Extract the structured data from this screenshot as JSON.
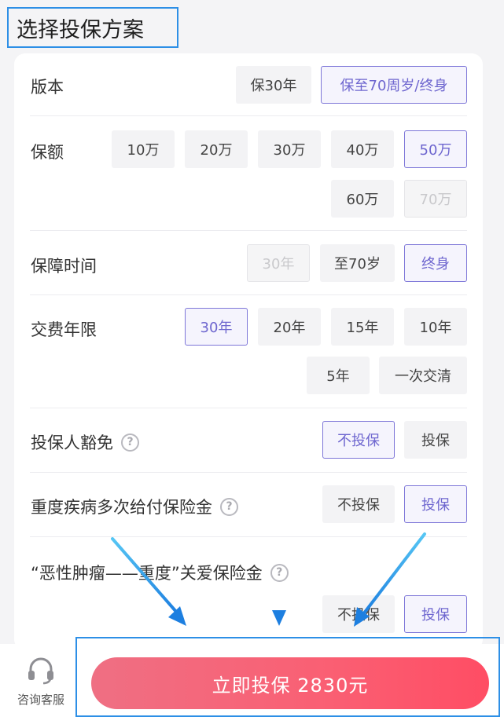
{
  "header": {
    "title": "选择投保方案"
  },
  "version": {
    "label": "版本",
    "options": [
      "保30年",
      "保至70周岁/终身"
    ]
  },
  "amount": {
    "label": "保额",
    "options": [
      "10万",
      "20万",
      "30万",
      "40万",
      "50万",
      "60万",
      "70万"
    ]
  },
  "coverage_period": {
    "label": "保障时间",
    "options": [
      "30年",
      "至70岁",
      "终身"
    ]
  },
  "payment_period": {
    "label": "交费年限",
    "options": [
      "30年",
      "20年",
      "15年",
      "10年",
      "5年",
      "一次交清"
    ]
  },
  "waiver": {
    "label": "投保人豁免",
    "help": "?",
    "options": [
      "不投保",
      "投保"
    ]
  },
  "multi_pay": {
    "label": "重度疾病多次给付保险金",
    "help": "?",
    "options": [
      "不投保",
      "投保"
    ]
  },
  "cancer": {
    "label": "“恶性肿瘤——重度”关爱保险金",
    "help": "?",
    "options": [
      "不投保",
      "投保"
    ]
  },
  "bottom_bar": {
    "service_label": "咨询客服",
    "buy_label": "立即投保 2830元"
  },
  "colors": {
    "accent": "#7d76d8",
    "buy_button": "#fa5f73",
    "highlight_frame": "#2d8fe6"
  }
}
